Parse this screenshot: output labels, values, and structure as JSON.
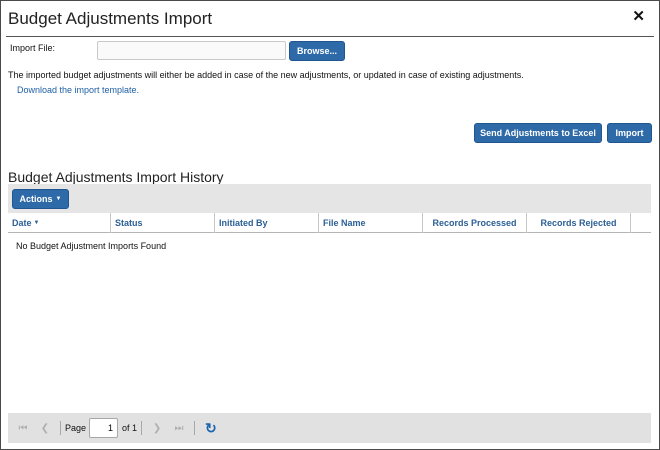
{
  "dialog": {
    "title": "Budget Adjustments Import",
    "close_glyph": "✕"
  },
  "import": {
    "file_label": "Import File:",
    "file_value": "",
    "browse_label": "Browse...",
    "info_text": "The imported budget adjustments will either be added in case of the new adjustments, or updated in case of existing adjustments.",
    "template_link": "Download the import template.",
    "send_excel_label": "Send Adjustments to Excel",
    "import_label": "Import"
  },
  "history": {
    "title": "Budget Adjustments Import History",
    "actions_label": "Actions",
    "columns": [
      "Date",
      "Status",
      "Initiated By",
      "File Name",
      "Records Processed",
      "Records Rejected"
    ],
    "sort_indicator": "▼",
    "empty_message": "No Budget Adjustment Imports Found"
  },
  "pager": {
    "page_label": "Page",
    "page_value": "1",
    "of_label": "of 1"
  },
  "icons": {
    "close": "close-icon",
    "caret": "caret-down-icon",
    "first": "first-page-icon",
    "prev": "prev-page-icon",
    "next": "next-page-icon",
    "last": "last-page-icon",
    "refresh": "refresh-icon"
  },
  "colors": {
    "button": "#2e6aa8",
    "link": "#1f5fa6",
    "header_text": "#2b5f95",
    "toolbar_bg": "#e5e5e5",
    "refresh": "#1d64b0"
  }
}
